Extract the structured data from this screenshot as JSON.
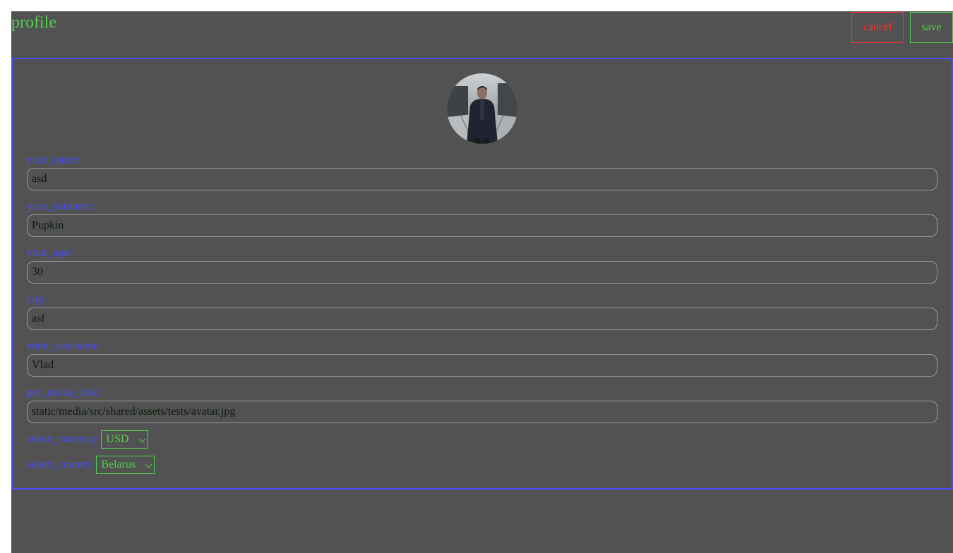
{
  "header": {
    "title": "profile",
    "cancel_label": "cancel",
    "save_label": "save"
  },
  "form": {
    "name": {
      "label": "your_name:",
      "value": "asd"
    },
    "surname": {
      "label": "your_surname:",
      "value": "Pupkin"
    },
    "age": {
      "label": "your_age:",
      "value": "30"
    },
    "city": {
      "label": "city:",
      "value": "asf"
    },
    "username": {
      "label": "enter_username:",
      "value": "Vlad"
    },
    "avatar_link": {
      "label": "put_avatar_link:",
      "value": "static/media/src/shared/assets/tests/avatar.jpg"
    },
    "currency": {
      "label": "select_currency",
      "value": "USD"
    },
    "country": {
      "label": "select_country",
      "value": "Belarus"
    }
  },
  "colors": {
    "background": "#525252",
    "accent_green": "#53cf4f",
    "accent_blue": "#4a4cff",
    "danger_red": "#ff2f2f"
  },
  "icons": {
    "avatar": "user-avatar-photo",
    "select_arrow": "chevron-down-icon"
  }
}
